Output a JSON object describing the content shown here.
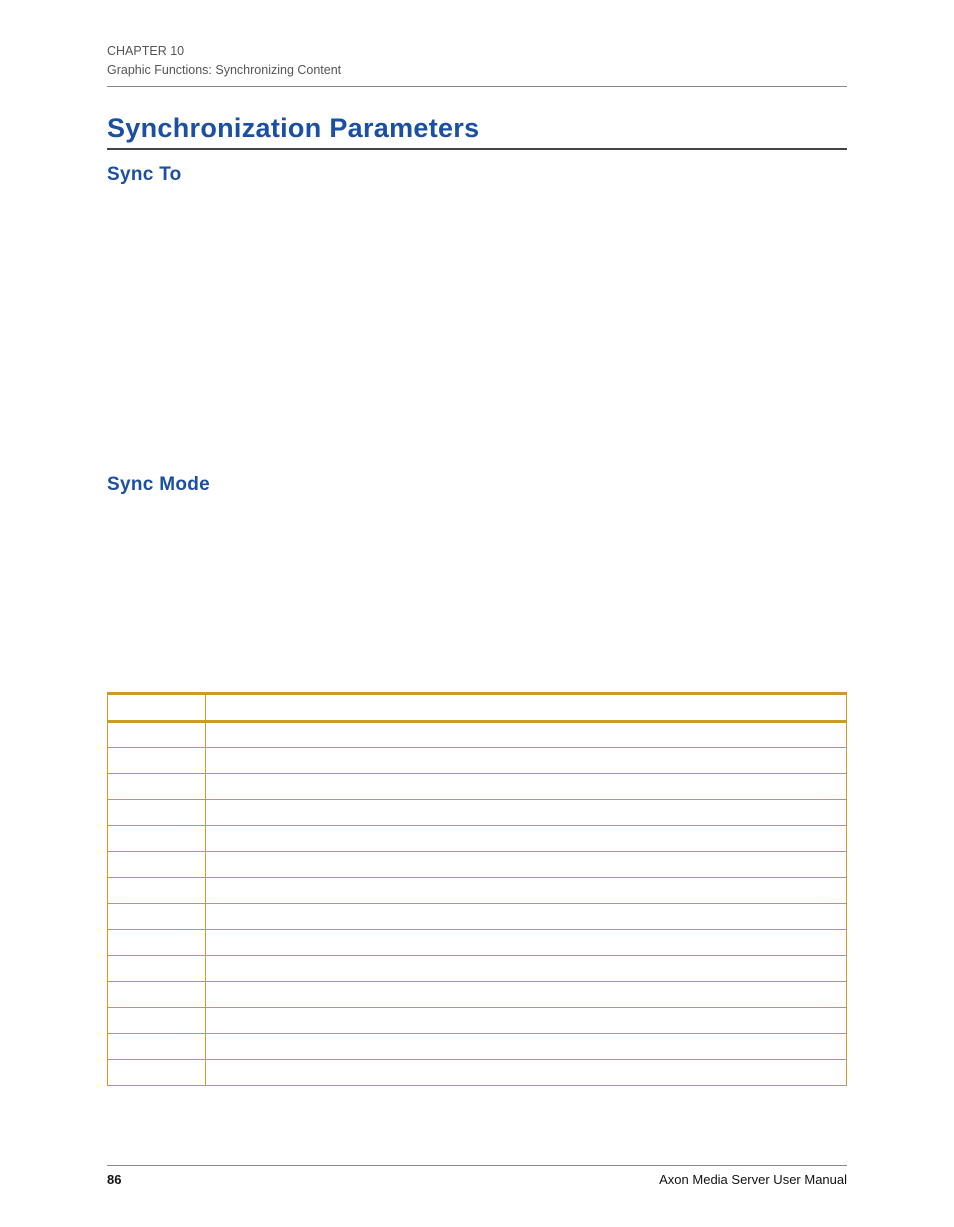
{
  "header": {
    "chapter": "CHAPTER 10",
    "section": "Graphic Functions: Synchronizing Content"
  },
  "main": {
    "title": "Synchronization Parameters",
    "sub1": "Sync To",
    "sub2": "Sync Mode"
  },
  "table": {
    "head": {
      "dmx": "",
      "desc": ""
    },
    "rows": [
      {
        "dmx": "",
        "desc": ""
      },
      {
        "dmx": "",
        "desc": ""
      },
      {
        "dmx": "",
        "desc": ""
      },
      {
        "dmx": "",
        "desc": ""
      },
      {
        "dmx": "",
        "desc": ""
      },
      {
        "dmx": "",
        "desc": ""
      },
      {
        "dmx": "",
        "desc": ""
      },
      {
        "dmx": "",
        "desc": ""
      },
      {
        "dmx": "",
        "desc": ""
      },
      {
        "dmx": "",
        "desc": ""
      },
      {
        "dmx": "",
        "desc": ""
      },
      {
        "dmx": "",
        "desc": ""
      },
      {
        "dmx": "",
        "desc": ""
      },
      {
        "dmx": "",
        "desc": ""
      }
    ]
  },
  "footer": {
    "page": "86",
    "doc": "Axon Media Server User Manual"
  }
}
